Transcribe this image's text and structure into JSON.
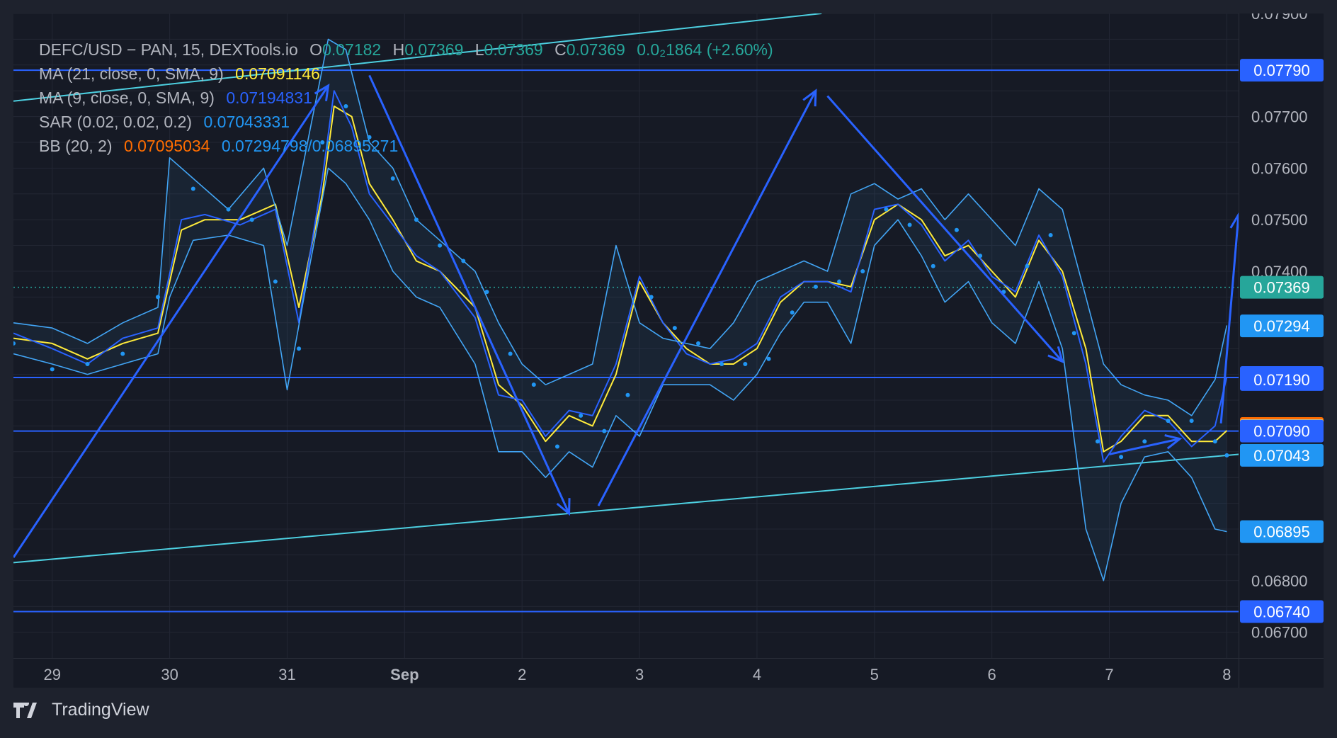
{
  "symbol": "DEFC/USD − PAN, 15, DEXTools.io",
  "ohlc": {
    "o_label": "O",
    "o": "0.07182",
    "h_label": "H",
    "h": "0.07369",
    "l_label": "L",
    "l": "0.07369",
    "c_label": "C",
    "c": "0.07369",
    "change": "0.0₂1864 (+2.60%)"
  },
  "indicators": {
    "ma21": {
      "label": "MA (21, close, 0, SMA, 9)",
      "value": "0.07091146"
    },
    "ma9": {
      "label": "MA (9, close, 0, SMA, 9)",
      "value": "0.07194831"
    },
    "sar": {
      "label": "SAR (0.02, 0.02, 0.2)",
      "value": "0.07043331"
    },
    "bb": {
      "label": "BB (20, 2)",
      "basis": "0.07095034",
      "upper": "0.07294798",
      "lower": "0.06895271"
    }
  },
  "brand": "TradingView",
  "colors": {
    "background": "#161a25",
    "grid": "#232734",
    "axis_text": "#b2b5be",
    "hline": "#2962ff",
    "trendline": "#4dd0e1",
    "arrow": "#2962ff",
    "bb": "#42a5f5",
    "ma21": "#ffeb3b",
    "ma9": "#2962ff",
    "sar": "#2196f3",
    "up": "#26a69a",
    "down": "#ef5350",
    "last": "#26a69a"
  },
  "chart_data": {
    "type": "line",
    "y_axis": {
      "min": 0.0665,
      "max": 0.079,
      "position": "right",
      "ticks": [
        "0.06700",
        "0.06800",
        "0.07400",
        "0.07500",
        "0.07600",
        "0.07700",
        "0.07900"
      ]
    },
    "x_axis": {
      "range": [
        28.67,
        39.1
      ],
      "ticks": [
        {
          "x": 29,
          "label": "29"
        },
        {
          "x": 30,
          "label": "30"
        },
        {
          "x": 31,
          "label": "31"
        },
        {
          "x": 32,
          "label": "Sep"
        },
        {
          "x": 33,
          "label": "2"
        },
        {
          "x": 34,
          "label": "3"
        },
        {
          "x": 35,
          "label": "4"
        },
        {
          "x": 36,
          "label": "5"
        },
        {
          "x": 37,
          "label": "6"
        },
        {
          "x": 38,
          "label": "7"
        },
        {
          "x": 39,
          "label": "8"
        }
      ]
    },
    "grid": true,
    "horizontal_lines": [
      0.0779,
      0.07194,
      0.0709,
      0.0674
    ],
    "last_price": 0.07369,
    "price_labels": [
      {
        "value": 0.0779,
        "label": "0.07790",
        "bg": "#2962ff",
        "fg": "#ffffff"
      },
      {
        "value": 0.07369,
        "label": "0.07369",
        "bg": "#26a69a",
        "fg": "#ffffff"
      },
      {
        "value": 0.07294,
        "label": "0.07294",
        "bg": "#2196f3",
        "fg": "#ffffff"
      },
      {
        "value": 0.07194,
        "label": "0.07194",
        "bg": "#2962ff",
        "fg": "#ffffff"
      },
      {
        "value": 0.0719,
        "label": "0.07190",
        "bg": "#2962ff",
        "fg": "#ffffff"
      },
      {
        "value": 0.07095,
        "label": "0.07095",
        "bg": "#ff6d00",
        "fg": "#ffffff"
      },
      {
        "value": 0.07091,
        "label": "0.07091",
        "bg": "#fff176",
        "fg": "#131722"
      },
      {
        "value": 0.0709,
        "label": "0.07090",
        "bg": "#2962ff",
        "fg": "#ffffff"
      },
      {
        "value": 0.07043,
        "label": "0.07043",
        "bg": "#2196f3",
        "fg": "#ffffff"
      },
      {
        "value": 0.06895,
        "label": "0.06895",
        "bg": "#2196f3",
        "fg": "#ffffff"
      },
      {
        "value": 0.0674,
        "label": "0.06740",
        "bg": "#2962ff",
        "fg": "#ffffff"
      }
    ],
    "trendlines": [
      {
        "x1": 28.67,
        "y1": 0.06835,
        "x2": 39.1,
        "y2": 0.07045
      },
      {
        "x1": 28.67,
        "y1": 0.0773,
        "x2": 35.55,
        "y2": 0.079
      }
    ],
    "arrows": [
      {
        "from": [
          28.67,
          0.06845
        ],
        "to": [
          31.35,
          0.0776
        ]
      },
      {
        "from": [
          31.7,
          0.0778
        ],
        "to": [
          33.4,
          0.0693
        ]
      },
      {
        "from": [
          33.65,
          0.06945
        ],
        "to": [
          35.5,
          0.0775
        ]
      },
      {
        "from": [
          35.6,
          0.0774
        ],
        "to": [
          37.6,
          0.07225
        ]
      },
      {
        "from": [
          38.0,
          0.07045
        ],
        "to": [
          38.6,
          0.07075
        ]
      },
      {
        "from": [
          38.95,
          0.07105
        ],
        "to": [
          39.1,
          0.0751
        ]
      }
    ],
    "series": [
      {
        "name": "MA 21",
        "x": [
          28.67,
          29.0,
          29.3,
          29.6,
          29.9,
          30.1,
          30.3,
          30.6,
          30.9,
          31.1,
          31.3,
          31.4,
          31.55,
          31.7,
          31.9,
          32.1,
          32.3,
          32.6,
          32.8,
          33.0,
          33.2,
          33.4,
          33.6,
          33.8,
          34.0,
          34.2,
          34.4,
          34.6,
          34.8,
          35.0,
          35.2,
          35.4,
          35.6,
          35.8,
          36.0,
          36.2,
          36.4,
          36.6,
          36.8,
          37.0,
          37.2,
          37.4,
          37.6,
          37.8,
          37.95,
          38.1,
          38.3,
          38.5,
          38.7,
          38.9,
          39.0
        ],
        "y": [
          0.0727,
          0.0726,
          0.0723,
          0.0726,
          0.0728,
          0.0748,
          0.075,
          0.075,
          0.0753,
          0.0733,
          0.0755,
          0.0772,
          0.077,
          0.0757,
          0.075,
          0.0742,
          0.074,
          0.0733,
          0.0718,
          0.0714,
          0.0707,
          0.0712,
          0.071,
          0.072,
          0.0738,
          0.073,
          0.0725,
          0.0722,
          0.0722,
          0.0725,
          0.0734,
          0.0738,
          0.0738,
          0.0737,
          0.075,
          0.0753,
          0.075,
          0.0743,
          0.0745,
          0.074,
          0.0735,
          0.0746,
          0.074,
          0.0725,
          0.0705,
          0.0707,
          0.0712,
          0.0712,
          0.0707,
          0.0707,
          0.07091
        ]
      },
      {
        "name": "MA 9",
        "x": [
          28.67,
          29.0,
          29.3,
          29.6,
          29.9,
          30.1,
          30.3,
          30.6,
          30.9,
          31.1,
          31.3,
          31.4,
          31.55,
          31.7,
          31.9,
          32.1,
          32.3,
          32.6,
          32.8,
          33.0,
          33.2,
          33.4,
          33.6,
          33.8,
          34.0,
          34.2,
          34.4,
          34.6,
          34.8,
          35.0,
          35.2,
          35.4,
          35.6,
          35.8,
          36.0,
          36.2,
          36.4,
          36.6,
          36.8,
          37.0,
          37.2,
          37.4,
          37.6,
          37.8,
          37.95,
          38.1,
          38.3,
          38.5,
          38.7,
          38.9,
          39.0
        ],
        "y": [
          0.0728,
          0.0725,
          0.0722,
          0.0727,
          0.0729,
          0.075,
          0.0751,
          0.0749,
          0.0752,
          0.073,
          0.0758,
          0.0775,
          0.0768,
          0.0755,
          0.0749,
          0.0743,
          0.074,
          0.0731,
          0.0716,
          0.0715,
          0.0708,
          0.0713,
          0.0712,
          0.0722,
          0.0739,
          0.073,
          0.0724,
          0.0722,
          0.0723,
          0.0726,
          0.0735,
          0.0738,
          0.0738,
          0.0736,
          0.0752,
          0.0753,
          0.0749,
          0.0742,
          0.0746,
          0.0739,
          0.0736,
          0.0747,
          0.0739,
          0.0722,
          0.0703,
          0.0708,
          0.0713,
          0.0711,
          0.0706,
          0.071,
          0.07195
        ]
      },
      {
        "name": "BB upper",
        "x": [
          28.67,
          29.0,
          29.3,
          29.6,
          29.9,
          30.0,
          30.2,
          30.5,
          30.8,
          31.0,
          31.2,
          31.35,
          31.5,
          31.7,
          31.9,
          32.1,
          32.3,
          32.6,
          32.8,
          33.0,
          33.2,
          33.4,
          33.6,
          33.8,
          34.0,
          34.2,
          34.4,
          34.6,
          34.8,
          35.0,
          35.2,
          35.4,
          35.6,
          35.8,
          36.0,
          36.2,
          36.4,
          36.6,
          36.8,
          37.0,
          37.2,
          37.4,
          37.6,
          37.8,
          37.95,
          38.1,
          38.3,
          38.5,
          38.7,
          38.9,
          39.0
        ],
        "y": [
          0.073,
          0.0729,
          0.0726,
          0.073,
          0.0733,
          0.0762,
          0.0758,
          0.0752,
          0.076,
          0.0745,
          0.0768,
          0.0785,
          0.0783,
          0.0765,
          0.076,
          0.075,
          0.0746,
          0.074,
          0.073,
          0.0722,
          0.0718,
          0.072,
          0.0722,
          0.0745,
          0.073,
          0.0727,
          0.0726,
          0.0725,
          0.073,
          0.0738,
          0.074,
          0.0742,
          0.074,
          0.0755,
          0.0757,
          0.0754,
          0.0756,
          0.075,
          0.0755,
          0.075,
          0.0745,
          0.0756,
          0.0752,
          0.0735,
          0.0722,
          0.0718,
          0.0716,
          0.0715,
          0.0712,
          0.0719,
          0.07295
        ]
      },
      {
        "name": "BB lower",
        "x": [
          28.67,
          29.0,
          29.3,
          29.6,
          29.9,
          30.0,
          30.2,
          30.5,
          30.8,
          31.0,
          31.2,
          31.35,
          31.5,
          31.7,
          31.9,
          32.1,
          32.3,
          32.6,
          32.8,
          33.0,
          33.2,
          33.4,
          33.6,
          33.8,
          34.0,
          34.2,
          34.4,
          34.6,
          34.8,
          35.0,
          35.2,
          35.4,
          35.6,
          35.8,
          36.0,
          36.2,
          36.4,
          36.6,
          36.8,
          37.0,
          37.2,
          37.4,
          37.6,
          37.8,
          37.95,
          38.1,
          38.3,
          38.5,
          38.7,
          38.9,
          39.0
        ],
        "y": [
          0.0724,
          0.0722,
          0.072,
          0.0722,
          0.0724,
          0.0735,
          0.0746,
          0.0747,
          0.0745,
          0.0717,
          0.0742,
          0.076,
          0.0757,
          0.075,
          0.074,
          0.0735,
          0.0733,
          0.0722,
          0.0705,
          0.0705,
          0.07,
          0.0705,
          0.0702,
          0.0712,
          0.0708,
          0.0718,
          0.0718,
          0.0718,
          0.0715,
          0.072,
          0.0728,
          0.0734,
          0.0734,
          0.0726,
          0.0745,
          0.075,
          0.0743,
          0.0734,
          0.0738,
          0.073,
          0.0726,
          0.0738,
          0.0725,
          0.069,
          0.068,
          0.0695,
          0.0704,
          0.0705,
          0.07,
          0.069,
          0.06895
        ]
      },
      {
        "name": "SAR",
        "style": "dots",
        "x": [
          28.67,
          29.0,
          29.3,
          29.6,
          29.9,
          30.2,
          30.5,
          30.7,
          30.9,
          31.1,
          31.3,
          31.5,
          31.7,
          31.9,
          32.1,
          32.3,
          32.5,
          32.7,
          32.9,
          33.1,
          33.3,
          33.5,
          33.7,
          33.9,
          34.1,
          34.3,
          34.5,
          34.7,
          34.9,
          35.1,
          35.3,
          35.5,
          35.7,
          35.9,
          36.1,
          36.3,
          36.5,
          36.7,
          36.9,
          37.1,
          37.3,
          37.5,
          37.7,
          37.9,
          38.1,
          38.3,
          38.5,
          38.7,
          38.9,
          39.0
        ],
        "y": [
          0.0726,
          0.0721,
          0.0722,
          0.0724,
          0.0735,
          0.0756,
          0.0752,
          0.075,
          0.0738,
          0.0725,
          0.0765,
          0.0772,
          0.0766,
          0.0758,
          0.075,
          0.0745,
          0.0742,
          0.0736,
          0.0724,
          0.0718,
          0.0706,
          0.0712,
          0.0709,
          0.0716,
          0.0735,
          0.0729,
          0.0726,
          0.0722,
          0.0722,
          0.0723,
          0.0732,
          0.0737,
          0.0738,
          0.074,
          0.0752,
          0.0749,
          0.0741,
          0.0748,
          0.0743,
          0.0736,
          0.0741,
          0.0747,
          0.0728,
          0.0707,
          0.0704,
          0.0707,
          0.0711,
          0.0711,
          0.0707,
          0.07043
        ]
      }
    ]
  }
}
